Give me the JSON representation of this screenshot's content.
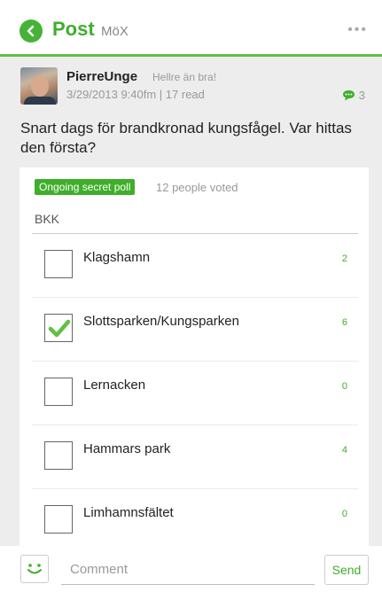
{
  "header": {
    "title": "Post",
    "subtitle": "MöX",
    "more_label": "•••"
  },
  "post": {
    "author": "PierreUnge",
    "author_tagline": "Hellre än bra!",
    "meta": "3/29/2013 9:40fm | 17 read",
    "comment_count": "3",
    "text": "Snart dags för brandkronad kungsfågel. Var hittas den första?"
  },
  "poll": {
    "badge": "Ongoing secret poll",
    "voted": "12 people voted",
    "group": "BKK",
    "options": [
      {
        "label": "Klagshamn",
        "count": "2",
        "checked": false
      },
      {
        "label": "Slottsparken/Kungsparken",
        "count": "6",
        "checked": true
      },
      {
        "label": "Lernacken",
        "count": "0",
        "checked": false
      },
      {
        "label": "Hammars park",
        "count": "4",
        "checked": false
      },
      {
        "label": "Limhamnsfältet",
        "count": "0",
        "checked": false
      }
    ]
  },
  "composer": {
    "placeholder": "Comment",
    "value": "",
    "send_label": "Send"
  },
  "colors": {
    "accent": "#3fae2a",
    "background": "#ededed"
  },
  "icons": {
    "back": "back-arrow-icon",
    "more": "more-dots-icon",
    "comment": "speech-bubble-icon",
    "smiley": "smiley-icon",
    "check": "checkmark-icon"
  }
}
